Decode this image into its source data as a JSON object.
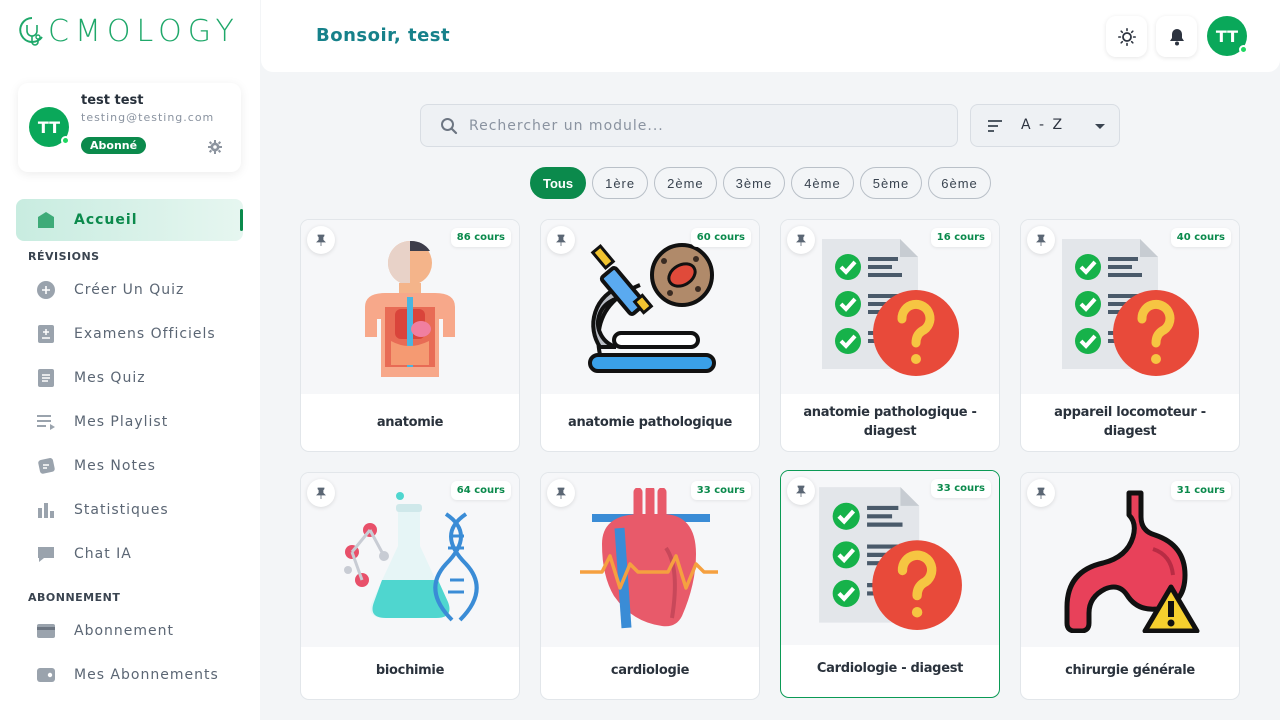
{
  "brand": {
    "name": "CMOLOGY",
    "accent": "#0b8a4c"
  },
  "user": {
    "initials": "TT",
    "name": "test test",
    "email": "testing@testing.com",
    "badge": "Abonné"
  },
  "header": {
    "greeting": "Bonsoir, test",
    "icons": [
      "sun-icon",
      "bell-icon"
    ]
  },
  "sidebar": {
    "active": {
      "label": "Accueil",
      "icon": "home-icon"
    },
    "sections": [
      {
        "label": "RÉVISIONS"
      },
      {
        "label": "ABONNEMENT"
      }
    ],
    "items": [
      {
        "label": "Créer Un Quiz",
        "icon": "plus-circle-icon"
      },
      {
        "label": "Examens Officiels",
        "icon": "exam-icon"
      },
      {
        "label": "Mes Quiz",
        "icon": "quiz-icon"
      },
      {
        "label": "Mes Playlist",
        "icon": "playlist-icon"
      },
      {
        "label": "Mes Notes",
        "icon": "notes-icon"
      },
      {
        "label": "Statistiques",
        "icon": "stats-icon"
      },
      {
        "label": "Chat IA",
        "icon": "chat-icon"
      },
      {
        "label": "Abonnement",
        "icon": "card-icon"
      },
      {
        "label": "Mes Abonnements",
        "icon": "wallet-icon"
      }
    ]
  },
  "search": {
    "placeholder": "Rechercher un module..."
  },
  "sort": {
    "value": "A - Z"
  },
  "filters": [
    "Tous",
    "1ère",
    "2ème",
    "3ème",
    "4ème",
    "5ème",
    "6ème"
  ],
  "active_filter": "Tous",
  "modules": [
    {
      "title": "anatomie",
      "count": "86 cours",
      "icon": "anatomy-body-icon"
    },
    {
      "title": "anatomie pathologique",
      "count": "60 cours",
      "icon": "microscope-icon"
    },
    {
      "title": "anatomie pathologique - diagest",
      "count": "16 cours",
      "icon": "checklist-question-icon"
    },
    {
      "title": "appareil locomoteur - diagest",
      "count": "40 cours",
      "icon": "checklist-question-icon"
    },
    {
      "title": "biochimie",
      "count": "64 cours",
      "icon": "flask-dna-icon"
    },
    {
      "title": "cardiologie",
      "count": "33 cours",
      "icon": "heart-icon"
    },
    {
      "title": "Cardiologie - diagest",
      "count": "33 cours",
      "icon": "checklist-question-icon"
    },
    {
      "title": "chirurgie générale",
      "count": "31 cours",
      "icon": "stomach-warning-icon"
    }
  ]
}
